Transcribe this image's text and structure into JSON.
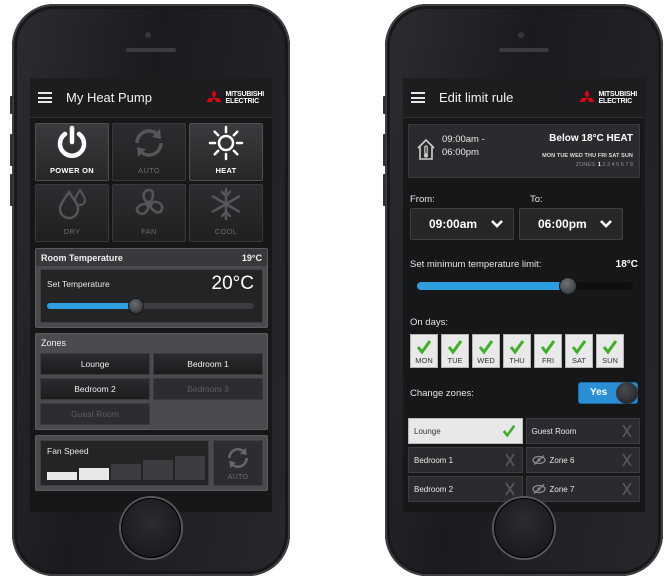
{
  "left": {
    "appbar": {
      "title": "My Heat Pump"
    },
    "brand": {
      "line1": "MITSUBISHI",
      "line2": "ELECTRIC"
    },
    "modes": [
      {
        "label": "POWER ON",
        "icon": "power-icon",
        "active": true
      },
      {
        "label": "AUTO",
        "icon": "auto-cycle-icon",
        "active": false
      },
      {
        "label": "HEAT",
        "icon": "sun-icon",
        "active": true
      },
      {
        "label": "DRY",
        "icon": "droplet-icon",
        "active": false
      },
      {
        "label": "FAN",
        "icon": "fan-icon",
        "active": false
      },
      {
        "label": "COOL",
        "icon": "snowflake-icon",
        "active": false
      }
    ],
    "room_temperature": {
      "label": "Room Temperature",
      "value": "19°C"
    },
    "set_temperature": {
      "label": "Set Temperature",
      "value": "20°C",
      "slider_fraction": 0.43
    },
    "zones": {
      "title": "Zones",
      "items": [
        {
          "label": "Lounge",
          "enabled": true
        },
        {
          "label": "Bedroom 1",
          "enabled": true
        },
        {
          "label": "Bedroom 2",
          "enabled": true
        },
        {
          "label": "Bedroom 3",
          "enabled": false
        },
        {
          "label": "Guest Room",
          "enabled": false
        }
      ]
    },
    "fan_speed": {
      "label": "Fan Speed",
      "levels": 5,
      "active_levels": 2,
      "auto_label": "AUTO"
    }
  },
  "right": {
    "appbar": {
      "title": "Edit limit rule"
    },
    "brand": {
      "line1": "MITSUBISHI",
      "line2": "ELECTRIC"
    },
    "summary": {
      "time_line1": "09:00am -",
      "time_line2": "06:00pm",
      "rule": "Below 18°C HEAT",
      "days": "MON TUE WED THU FRI SAT SUN",
      "zones_label": "ZONES:",
      "zones_active": "1",
      "zones_rest": "2 3 4 5 6 7 8"
    },
    "from": {
      "label": "From:",
      "value": "09:00am"
    },
    "to": {
      "label": "To:",
      "value": "06:00pm"
    },
    "min_limit": {
      "label": "Set minimum temperature limit:",
      "value": "18°C",
      "slider_fraction": 0.7
    },
    "on_days": {
      "label": "On days:",
      "days": [
        "MON",
        "TUE",
        "WED",
        "THU",
        "FRI",
        "SAT",
        "SUN"
      ]
    },
    "change_zones": {
      "label": "Change zones:",
      "toggle_label": "Yes",
      "enabled": true
    },
    "zones": [
      {
        "label": "Lounge",
        "selected": true,
        "icon": ""
      },
      {
        "label": "Guest Room",
        "selected": false,
        "icon": ""
      },
      {
        "label": "Bedroom 1",
        "selected": false,
        "icon": ""
      },
      {
        "label": "Zone 6",
        "selected": false,
        "icon": "eye-off-icon"
      },
      {
        "label": "Bedroom 2",
        "selected": false,
        "icon": ""
      },
      {
        "label": "Zone 7",
        "selected": false,
        "icon": "eye-off-icon"
      }
    ]
  },
  "colors": {
    "accent_blue": "#2d9fe0",
    "check_green": "#3fae2a",
    "brand_red": "#e60012"
  }
}
